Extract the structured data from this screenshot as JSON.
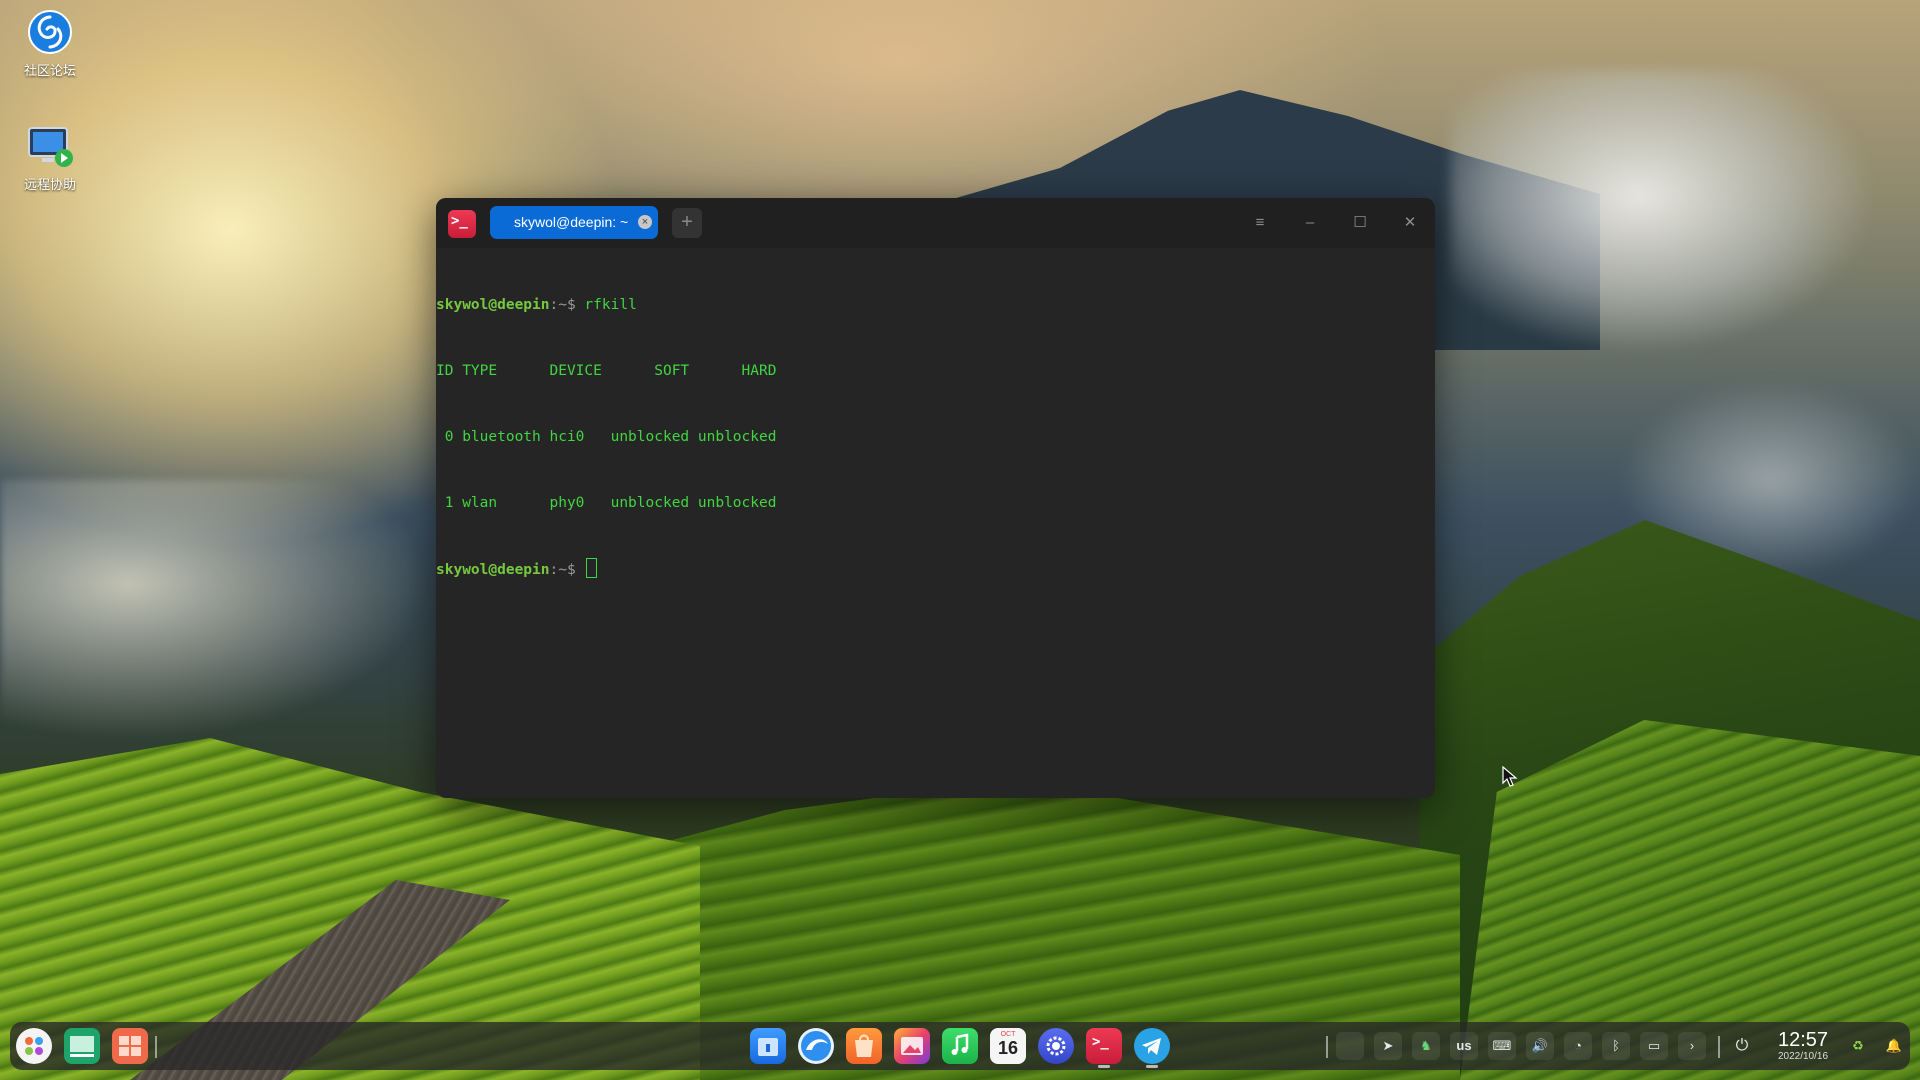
{
  "desktop": {
    "icons": [
      {
        "label": "社区论坛",
        "icon": "deepin-forum-icon"
      },
      {
        "label": "远程协助",
        "icon": "remote-assist-icon"
      }
    ]
  },
  "terminal": {
    "tab_title": "skywol@deepin: ~",
    "new_tab": "+",
    "window_buttons": {
      "menu": "≡",
      "minimize": "–",
      "maximize": "☐",
      "close": "✕"
    },
    "lines": [
      {
        "user": "skywol@deepin",
        "sep": ":~$",
        "cmd": " rfkill"
      },
      {
        "text": "ID TYPE      DEVICE      SOFT      HARD"
      },
      {
        "text": " 0 bluetooth hci0   unblocked unblocked"
      },
      {
        "text": " 1 wlan      phy0   unblocked unblocked"
      },
      {
        "user": "skywol@deepin",
        "sep": ":~$",
        "cmd": " "
      }
    ]
  },
  "dock": {
    "left_apps": [
      "launcher-icon",
      "multitasking-view-icon",
      "workspace-icon"
    ],
    "apps": [
      "file-manager-icon",
      "browser-icon",
      "app-store-icon",
      "image-viewer-icon",
      "music-icon",
      "calendar-icon",
      "control-center-icon",
      "terminal-icon",
      "telegram-icon"
    ],
    "calendar_day": "16",
    "tray": {
      "keyboard_layout": "us",
      "time": "12:57",
      "date": "2022/10/16"
    }
  },
  "colors": {
    "terminal_bg": "#252525",
    "terminal_text": "#42d442",
    "tab_active": "#0a6bd6",
    "terminal_logo": "#e0304d"
  }
}
